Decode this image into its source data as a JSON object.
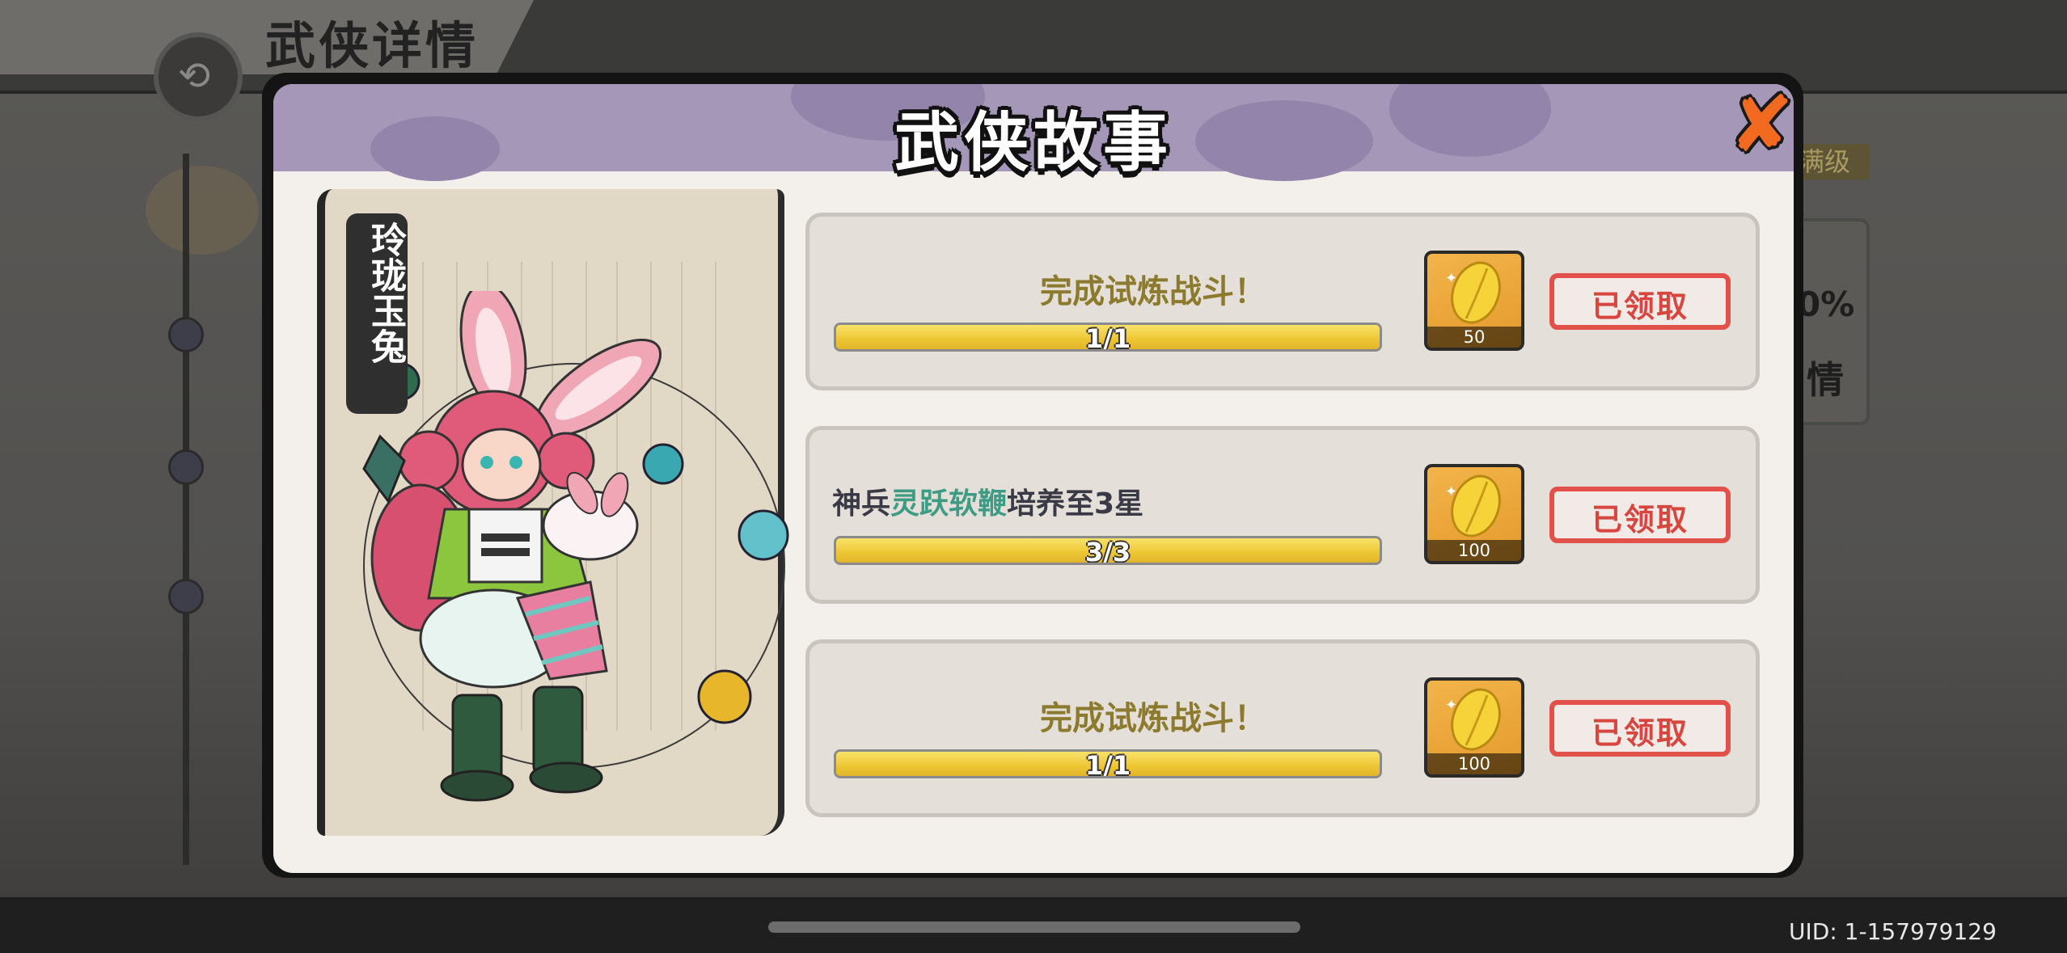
{
  "background": {
    "page_title": "武侠详情",
    "right_badge": "满级",
    "right_percent": "0%",
    "right_char": "情"
  },
  "modal": {
    "title": "武侠故事",
    "close_icon": "close-x-icon"
  },
  "character": {
    "name": "玲珑玉兔"
  },
  "tasks": [
    {
      "text": "完成试炼战斗！",
      "progress_text": "1/1",
      "progress_fraction": 1.0,
      "reward_icon": "gold-leaf-icon",
      "reward_count": "50",
      "status": "已领取"
    },
    {
      "text_prefix": "神兵",
      "text_highlight": "灵跃软鞭",
      "text_suffix": "培养至3星",
      "progress_text": "3/3",
      "progress_fraction": 1.0,
      "reward_icon": "gold-leaf-icon",
      "reward_count": "100",
      "status": "已领取"
    },
    {
      "text": "完成试炼战斗！",
      "progress_text": "1/1",
      "progress_fraction": 1.0,
      "reward_icon": "gold-leaf-icon",
      "reward_count": "100",
      "status": "已领取"
    }
  ],
  "footer": {
    "uid": "UID:  1-157979129"
  },
  "colors": {
    "header_purple": "#a597b8",
    "claimed_red": "#e2504a",
    "progress_yellow": "#f0d03d",
    "highlight_green": "#3f9c84",
    "close_orange": "#f26a1f"
  }
}
